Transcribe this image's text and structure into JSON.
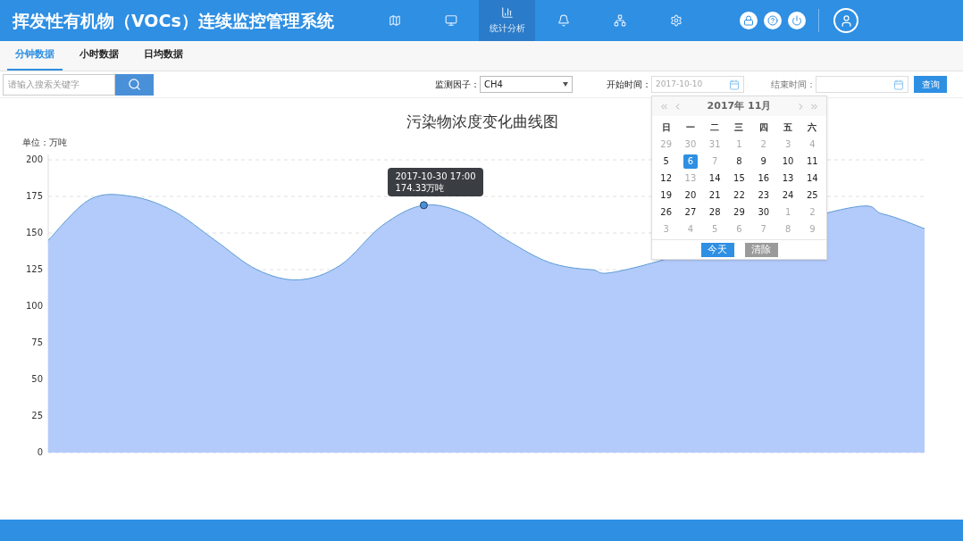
{
  "header": {
    "title": "挥发性有机物（VOCs）连续监控管理系统",
    "nav": [
      {
        "kind": "map",
        "selected": false
      },
      {
        "kind": "monitor",
        "selected": false
      },
      {
        "label": "统计分析",
        "kind": "chart",
        "selected": true
      },
      {
        "kind": "alarm",
        "selected": false
      },
      {
        "kind": "sites",
        "selected": false
      },
      {
        "kind": "settings",
        "selected": false
      }
    ],
    "actions": [
      {
        "kind": "lock"
      },
      {
        "kind": "help"
      },
      {
        "kind": "power"
      }
    ]
  },
  "tabs": [
    {
      "label": "分钟数据",
      "selected": true
    },
    {
      "label": "小时数据",
      "selected": false
    },
    {
      "label": "日均数据",
      "selected": false
    }
  ],
  "search": {
    "placeholder": "请输入搜索关键字"
  },
  "filters": {
    "factor_label": "监测因子：",
    "factor_value": "CH4",
    "start_label": "开始时间：",
    "start_value": "2017-10-10",
    "end_label": "结束时间：",
    "query_button": "查询"
  },
  "calendar": {
    "title": "2017年 11月",
    "weekdays": [
      "日",
      "一",
      "二",
      "三",
      "四",
      "五",
      "六"
    ],
    "days": [
      {
        "label": "29",
        "muted": true,
        "selected": false
      },
      {
        "label": "30",
        "muted": true,
        "selected": false
      },
      {
        "label": "31",
        "muted": true,
        "selected": false
      },
      {
        "label": "1",
        "muted": true,
        "selected": false
      },
      {
        "label": "2",
        "muted": true,
        "selected": false
      },
      {
        "label": "3",
        "muted": true,
        "selected": false
      },
      {
        "label": "4",
        "muted": true,
        "selected": false
      },
      {
        "label": "5",
        "muted": false,
        "selected": false
      },
      {
        "label": "6",
        "muted": false,
        "selected": true
      },
      {
        "label": "7",
        "muted": true,
        "selected": false
      },
      {
        "label": "8",
        "muted": false,
        "selected": false
      },
      {
        "label": "9",
        "muted": false,
        "selected": false
      },
      {
        "label": "10",
        "muted": false,
        "selected": false
      },
      {
        "label": "11",
        "muted": false,
        "selected": false
      },
      {
        "label": "12",
        "muted": false,
        "selected": false
      },
      {
        "label": "13",
        "muted": true,
        "selected": false
      },
      {
        "label": "14",
        "muted": false,
        "selected": false
      },
      {
        "label": "15",
        "muted": false,
        "selected": false
      },
      {
        "label": "16",
        "muted": false,
        "selected": false
      },
      {
        "label": "13",
        "muted": false,
        "selected": false
      },
      {
        "label": "14",
        "muted": false,
        "selected": false
      },
      {
        "label": "19",
        "muted": false,
        "selected": false
      },
      {
        "label": "20",
        "muted": false,
        "selected": false
      },
      {
        "label": "21",
        "muted": false,
        "selected": false
      },
      {
        "label": "22",
        "muted": false,
        "selected": false
      },
      {
        "label": "23",
        "muted": false,
        "selected": false
      },
      {
        "label": "24",
        "muted": false,
        "selected": false
      },
      {
        "label": "25",
        "muted": false,
        "selected": false
      },
      {
        "label": "26",
        "muted": false,
        "selected": false
      },
      {
        "label": "27",
        "muted": false,
        "selected": false
      },
      {
        "label": "28",
        "muted": false,
        "selected": false
      },
      {
        "label": "29",
        "muted": false,
        "selected": false
      },
      {
        "label": "30",
        "muted": false,
        "selected": false
      },
      {
        "label": "1",
        "muted": true,
        "selected": false
      },
      {
        "label": "2",
        "muted": true,
        "selected": false
      },
      {
        "label": "3",
        "muted": true,
        "selected": false
      },
      {
        "label": "4",
        "muted": true,
        "selected": false
      },
      {
        "label": "5",
        "muted": true,
        "selected": false
      },
      {
        "label": "6",
        "muted": true,
        "selected": false
      },
      {
        "label": "7",
        "muted": true,
        "selected": false
      },
      {
        "label": "8",
        "muted": true,
        "selected": false
      },
      {
        "label": "9",
        "muted": true,
        "selected": false
      }
    ],
    "today_button": "今天",
    "clear_button": "清除"
  },
  "chart": {
    "unit": "单位：万吨",
    "tooltip": {
      "time": "2017-10-30 17:00",
      "value": "174.33万吨"
    },
    "chart_data": {
      "type": "area",
      "title": "污染物浓度变化曲线图",
      "grid": true,
      "ylim": [
        0,
        200
      ],
      "yticks": [
        0,
        25,
        50,
        75,
        100,
        125,
        150,
        175,
        200
      ],
      "series": [
        {
          "color": "#b3cbfa",
          "values": [
            145,
            173,
            175,
            165,
            145,
            125,
            118,
            128,
            155,
            169,
            163,
            145,
            130,
            125,
            126,
            null,
            null,
            null,
            null,
            166,
            163,
            153
          ]
        }
      ]
    }
  }
}
